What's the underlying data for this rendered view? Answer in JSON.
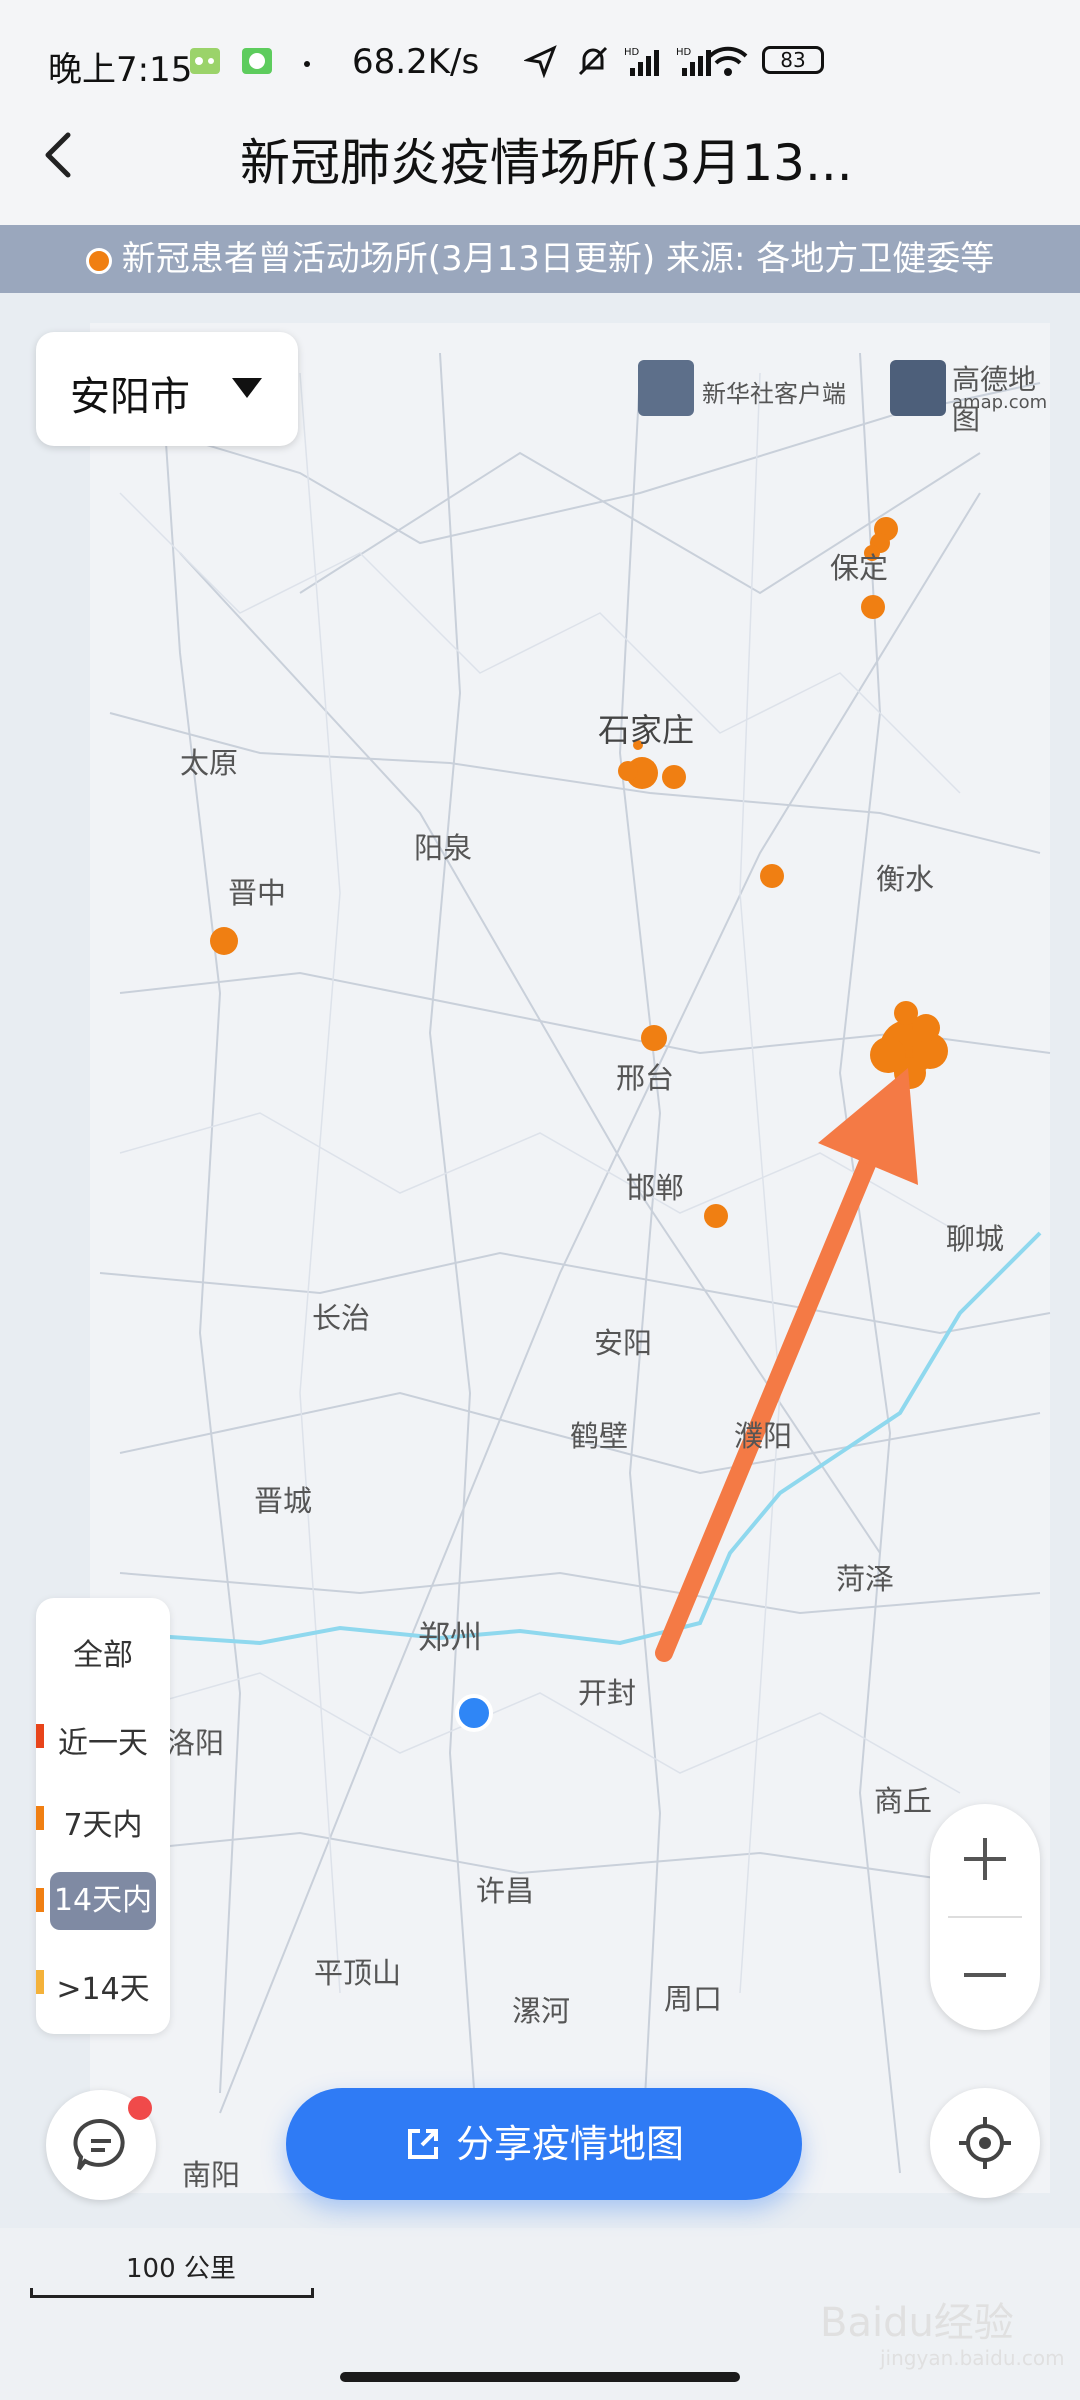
{
  "status_bar": {
    "time": "晚上7:15",
    "net_speed": "68.2K/s",
    "battery": "83"
  },
  "header": {
    "title": "新冠肺炎疫情场所(3月13..."
  },
  "banner": {
    "text": "新冠患者曾活动场所(3月13日更新) 来源: 各地方卫健委等"
  },
  "city_selector": {
    "value": "安阳市"
  },
  "logos": {
    "xinhua": "新华社客户端",
    "amap": "高德地图",
    "amap_url": "amap.com"
  },
  "map": {
    "labels": [
      {
        "name": "保定"
      },
      {
        "name": "石家庄"
      },
      {
        "name": "太原"
      },
      {
        "name": "阳泉"
      },
      {
        "name": "晋中"
      },
      {
        "name": "衡水"
      },
      {
        "name": "邢台"
      },
      {
        "name": "邯郸"
      },
      {
        "name": "聊城"
      },
      {
        "name": "长治"
      },
      {
        "name": "安阳"
      },
      {
        "name": "鹤壁"
      },
      {
        "name": "濮阳"
      },
      {
        "name": "晋城"
      },
      {
        "name": "菏泽"
      },
      {
        "name": "郑州"
      },
      {
        "name": "开封"
      },
      {
        "name": "洛阳"
      },
      {
        "name": "商丘"
      },
      {
        "name": "许昌"
      },
      {
        "name": "平顶山"
      },
      {
        "name": "漯河"
      },
      {
        "name": "周口"
      },
      {
        "name": "南阳"
      }
    ],
    "marker_color": "#f07f12",
    "user_location_color": "#2f86f6",
    "arrow_color": "#f47a45",
    "river_color": "#7ad0ea"
  },
  "legend": {
    "all": "全部",
    "items": [
      {
        "label": "近一天",
        "color": "#e8441a"
      },
      {
        "label": "7天内",
        "color": "#f07f12"
      },
      {
        "label": "14天内",
        "color": "#f07f12"
      },
      {
        "label": ">14天",
        "color": "#f4b23a"
      }
    ]
  },
  "share_button": {
    "label": "分享疫情地图"
  },
  "scale": {
    "label": "100 公里"
  },
  "watermark": {
    "text": "Baidu经验",
    "sub": "jingyan.baidu.com"
  }
}
